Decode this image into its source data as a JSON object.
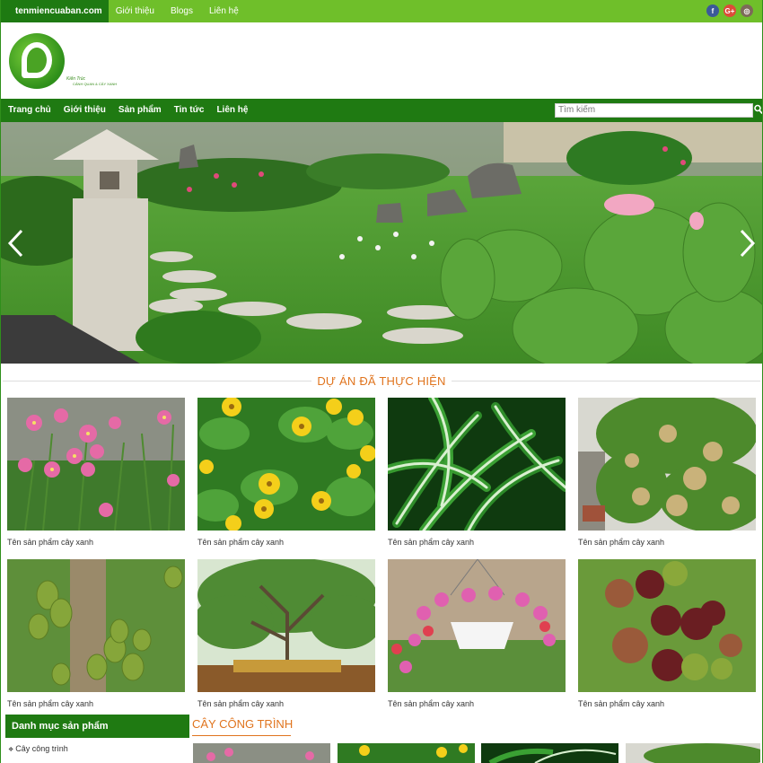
{
  "topbar": {
    "domain": "tenmiencuaban.com",
    "links": [
      "Giới thiệu",
      "Blogs",
      "Liên hệ"
    ],
    "social": [
      {
        "icon": "facebook-icon",
        "glyph": "f"
      },
      {
        "icon": "google-plus-icon",
        "glyph": "G+"
      },
      {
        "icon": "instagram-icon",
        "glyph": "◎"
      }
    ]
  },
  "logo": {
    "script": "Kiến Trúc",
    "tagline": "CẢNH QUAN & CÂY XANH"
  },
  "nav": {
    "items": [
      "Trang chủ",
      "Giới thiệu",
      "Sản phẩm",
      "Tin tức",
      "Liên hệ"
    ],
    "search_placeholder": "Tìm kiếm"
  },
  "section": {
    "title": "DỰ ÁN ĐÃ THỰC HIỆN"
  },
  "products": [
    {
      "name": "Tên sản phẩm cây xanh",
      "image": "pink-flowers"
    },
    {
      "name": "Tên sản phẩm cây xanh",
      "image": "yellow-daisies"
    },
    {
      "name": "Tên sản phẩm cây xanh",
      "image": "striped-leaves"
    },
    {
      "name": "Tên sản phẩm cây xanh",
      "image": "longan-tree"
    },
    {
      "name": "Tên sản phẩm cây xanh",
      "image": "jackfruit-tree"
    },
    {
      "name": "Tên sản phẩm cây xanh",
      "image": "big-tree"
    },
    {
      "name": "Tên sản phẩm cây xanh",
      "image": "hanging-basket"
    },
    {
      "name": "Tên sản phẩm cây xanh",
      "image": "fruit-cluster"
    }
  ],
  "sidebar": {
    "heading": "Danh mục sản phẩm",
    "items": [
      "Cây công trình"
    ]
  },
  "category": {
    "title": "CÂY CÔNG TRÌNH"
  },
  "colors": {
    "brand_green": "#1f7a12",
    "topbar_green": "#6fbf2a",
    "accent_orange": "#e0741e"
  }
}
